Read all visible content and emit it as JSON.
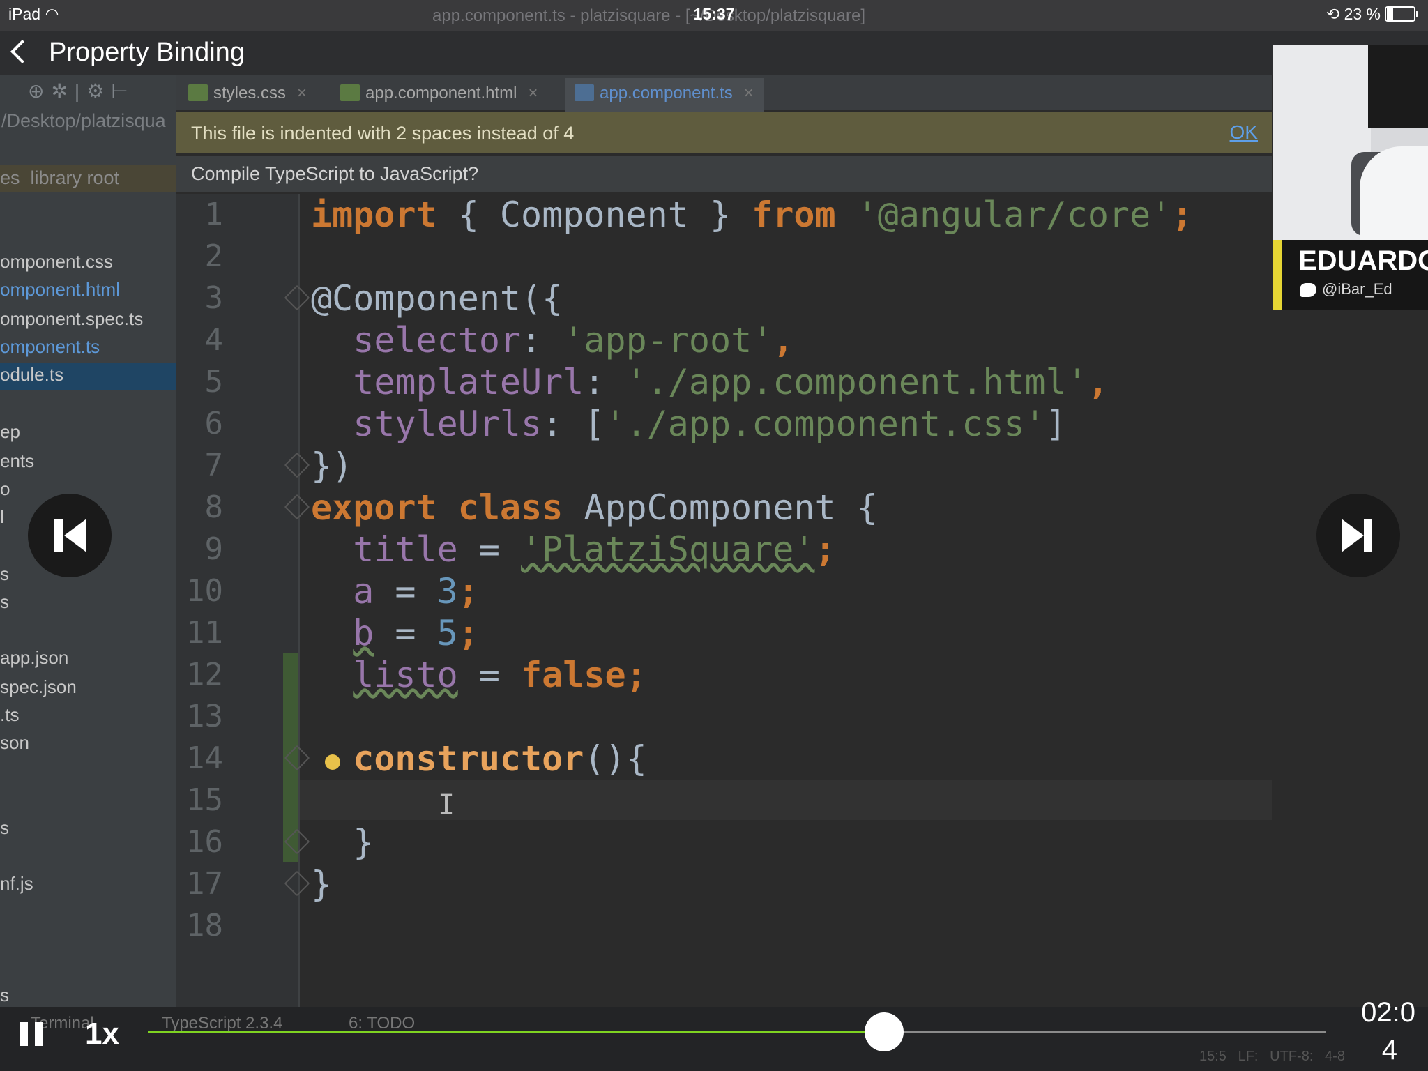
{
  "status_bar": {
    "device": "iPad",
    "time": "15:37",
    "battery": "23 %",
    "window_title": "app.component.ts - platzisquare - [~/Desktop/platzisquare]"
  },
  "nav": {
    "title": "Property Binding"
  },
  "sidebar": {
    "path": "/Desktop/platzisqua",
    "root_label": "es  library root",
    "items": [
      "omponent.css",
      "omponent.html",
      "omponent.spec.ts",
      "omponent.ts",
      "odule.ts",
      "ep",
      "ents",
      "o",
      "l",
      "s",
      "s",
      "app.json",
      "spec.json",
      ".ts",
      "son",
      "s",
      "nf.js",
      "s"
    ]
  },
  "tabs": [
    {
      "label": "styles.css"
    },
    {
      "label": "app.component.html"
    },
    {
      "label": "app.component.ts"
    }
  ],
  "notice": {
    "text": "This file is indented with 2 spaces instead of 4",
    "ok": "OK"
  },
  "compile_prompt": "Compile TypeScript to JavaScript?",
  "line_numbers": [
    "1",
    "2",
    "3",
    "4",
    "5",
    "6",
    "7",
    "8",
    "9",
    "10",
    "11",
    "12",
    "13",
    "14",
    "15",
    "16",
    "17",
    "18"
  ],
  "code": {
    "l1": {
      "kw1": "import",
      "mid": " { Component } ",
      "kw2": "from",
      "str": " '@angular/core'",
      "end": ";"
    },
    "l3": {
      "text": "@Component({"
    },
    "l4": {
      "key": "selector",
      "colon": ": ",
      "str": "'app-root'",
      "end": ","
    },
    "l5": {
      "key": "templateUrl",
      "colon": ": ",
      "str": "'./app.component.html'",
      "end": ","
    },
    "l6": {
      "key": "styleUrls",
      "colon": ": [",
      "str": "'./app.component.css'",
      "end": "]"
    },
    "l7": {
      "text": "})"
    },
    "l8": {
      "kw": "export class",
      "name": " AppComponent {"
    },
    "l9": {
      "key": "title",
      "eq": " = ",
      "str": "'PlatziSquare'",
      "end": ";"
    },
    "l10": {
      "key": "a",
      "eq": " = ",
      "num": "3",
      "end": ";"
    },
    "l11": {
      "key": "b",
      "eq": " = ",
      "num": "5",
      "end": ";"
    },
    "l12": {
      "key": "listo",
      "eq": " = ",
      "kw": "false",
      "end": ";"
    },
    "l14": {
      "fn": "constructor",
      "end": "(){"
    },
    "l16": {
      "text": "}"
    },
    "l17": {
      "text": "}"
    }
  },
  "bottom_bar": {
    "terminal": "Terminal",
    "typescript": "TypeScript 2.3.4",
    "todo": "6: TODO",
    "status": "15:5   LF:   UTF-8:   4-8"
  },
  "webcam": {
    "name": "EDUARDO IBA",
    "handle": "@iBar_Ed"
  },
  "player": {
    "speed": "1x",
    "time_line1": "02:0",
    "time_line2": "4",
    "progress": 0.625
  }
}
